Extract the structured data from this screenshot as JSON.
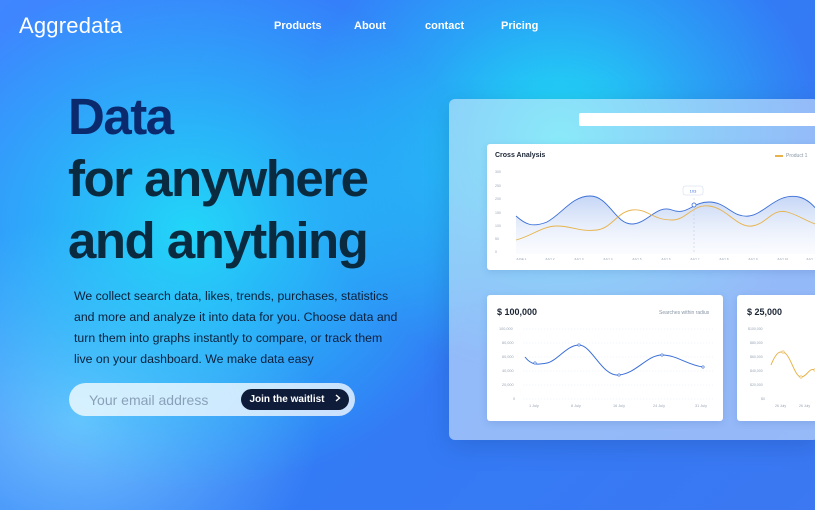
{
  "brand": {
    "name": "Aggredata"
  },
  "nav": {
    "items": [
      "Products",
      "About",
      "contact",
      "Pricing"
    ]
  },
  "hero": {
    "line1": "Data",
    "line2": "for anywhere",
    "line3": "and anything"
  },
  "description": "We collect search data, likes, trends, purchases, statistics and more and analyze it into data for you. Choose data and turn them into graphs instantly to compare, or track them live on your dashboard. We make data easy",
  "signup": {
    "placeholder": "Your email address",
    "button_label": "Join the waitlist",
    "button_icon": "chevron-right-icon"
  },
  "colors": {
    "primary_line": "#3b6fd8",
    "secondary_line": "#e8b34a",
    "dark_button": "#0e1c3a",
    "hero_title": "#0b2a6e"
  },
  "cross_analysis": {
    "title": "Cross Analysis",
    "legend": "Product 1",
    "y_ticks": [
      "300",
      "250",
      "200",
      "150",
      "100",
      "50",
      "0"
    ],
    "x_ticks": [
      "JUNE 1",
      "JULY 2",
      "JULY 3",
      "JULY 4",
      "JULY 5",
      "JULY 6",
      "JULY 7",
      "JULY 8",
      "JULY 9",
      "JULY 10",
      "JULY"
    ],
    "tooltip": "103"
  },
  "card_a": {
    "value": "$ 100,000",
    "subtitle": "Searches within radius",
    "y_ticks": [
      "100,000",
      "80,000",
      "60,000",
      "40,000",
      "20,000",
      "0"
    ],
    "x_ticks": [
      "1 July",
      "8 July",
      "16 July",
      "24 July",
      "31 July"
    ]
  },
  "card_b": {
    "value": "$ 25,000",
    "y_ticks": [
      "$100,000",
      "$80,000",
      "$60,000",
      "$40,000",
      "$20,000",
      "$0"
    ],
    "x_ticks": [
      "26 July",
      "26 July"
    ]
  }
}
